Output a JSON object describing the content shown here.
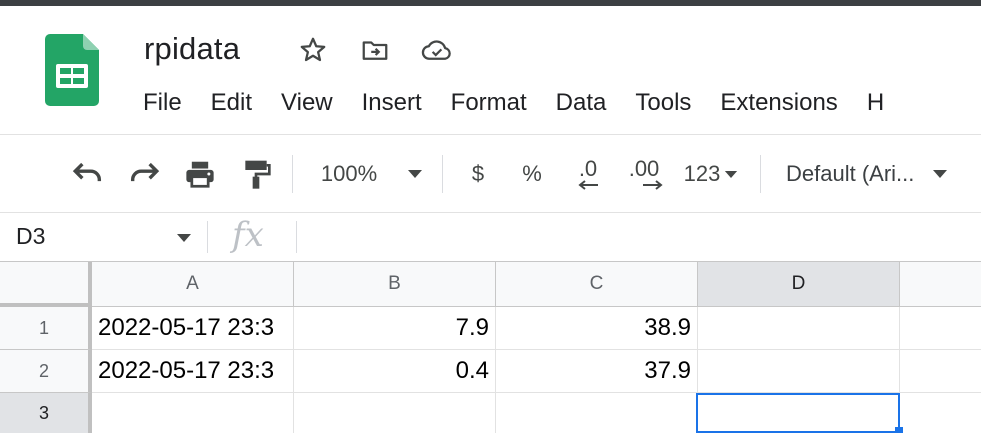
{
  "document": {
    "title": "rpidata"
  },
  "menu": [
    "File",
    "Edit",
    "View",
    "Insert",
    "Format",
    "Data",
    "Tools",
    "Extensions",
    "H"
  ],
  "toolbar": {
    "zoom": "100%",
    "currency": "$",
    "percent": "%",
    "decrease_decimals": ".0",
    "increase_decimals": ".00",
    "number_format": "123",
    "font": "Default (Ari..."
  },
  "formula_bar": {
    "name_box": "D3",
    "fx": "fx",
    "value": ""
  },
  "columns": [
    "A",
    "B",
    "C",
    "D"
  ],
  "rows": [
    {
      "num": "1",
      "cells": [
        "2022-05-17 23:3",
        "7.9",
        "38.9",
        ""
      ]
    },
    {
      "num": "2",
      "cells": [
        "2022-05-17 23:3",
        "0.4",
        "37.9",
        ""
      ]
    },
    {
      "num": "3",
      "cells": [
        "",
        "",
        "",
        ""
      ]
    }
  ],
  "colors": {
    "sheets_green": "#23a566",
    "selection": "#1a73e8"
  },
  "icons": {
    "title": [
      "star-icon",
      "move-to-folder-icon",
      "cloud-saved-icon"
    ],
    "toolbar": [
      "undo-icon",
      "redo-icon",
      "print-icon",
      "paint-format-icon"
    ]
  }
}
